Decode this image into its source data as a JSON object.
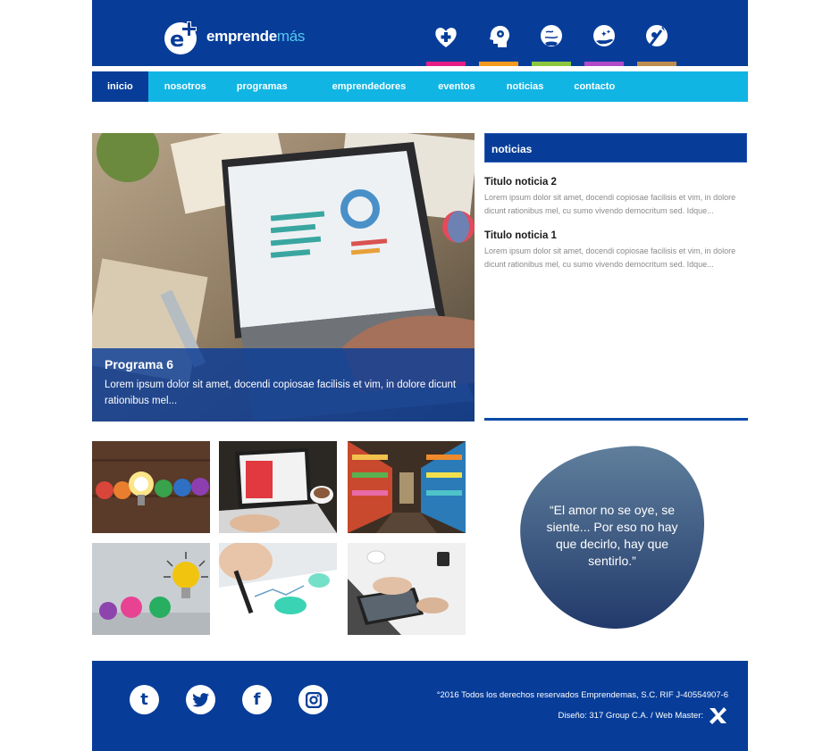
{
  "brand": {
    "name_main": "emprende",
    "name_accent": "más",
    "colors": {
      "primary": "#073d99",
      "nav": "#11b5e4",
      "accent": "#55c8ee"
    }
  },
  "categories": [
    {
      "icon": "heart-plus-icon",
      "color": "#e41e86"
    },
    {
      "icon": "head-gear-icon",
      "color": "#f39a1f"
    },
    {
      "icon": "globe-hand-icon",
      "color": "#8cc63f"
    },
    {
      "icon": "hand-stars-icon",
      "color": "#b04ac9"
    },
    {
      "icon": "idea-arrow-icon",
      "color": "#c08b4e"
    }
  ],
  "nav": {
    "items": [
      "inicio",
      "nosotros",
      "programas",
      "emprendedores",
      "eventos",
      "noticias",
      "contacto"
    ],
    "active": "inicio"
  },
  "hero": {
    "title": "Programa 6",
    "text": "Lorem ipsum dolor sit amet, docendi copiosae facilisis et vim, in dolore dicunt rationibus mel..."
  },
  "news": {
    "header": "noticias",
    "items": [
      {
        "title": "Titulo noticia 2",
        "body": "Lorem ipsum dolor sit amet, docendi copiosae facilisis et vim, in dolore dicunt rationibus mel, cu sumo vivendo democritum sed. Idque..."
      },
      {
        "title": "Titulo noticia 1",
        "body": "Lorem ipsum dolor sit amet, docendi copiosae facilisis et vim, in dolore dicunt rationibus mel, cu sumo vivendo democritum sed. Idque..."
      }
    ]
  },
  "gallery": [
    {
      "name": "crumpled-paper-lightbulb-photo"
    },
    {
      "name": "laptop-coffee-photo"
    },
    {
      "name": "bookstore-photo"
    },
    {
      "name": "crumpled-paper-idea-photo"
    },
    {
      "name": "pen-charts-photo"
    },
    {
      "name": "tablet-desk-photo"
    }
  ],
  "quote": {
    "text": "“El amor no se oye, se siente... Por eso no hay que decirlo, hay que sentirlo.”"
  },
  "footer": {
    "socials": [
      {
        "icon": "tumblr-icon",
        "glyph": "t"
      },
      {
        "icon": "twitter-icon",
        "glyph": "🐦"
      },
      {
        "icon": "facebook-icon",
        "glyph": "f"
      },
      {
        "icon": "instagram-icon",
        "glyph": "◎"
      }
    ],
    "copyright": "°2016 Todos los derechos reservados Emprendemas, S.C. RIF J-40554907-6",
    "credit": "Diseño: 317 Group C.A. / Web Master:"
  }
}
